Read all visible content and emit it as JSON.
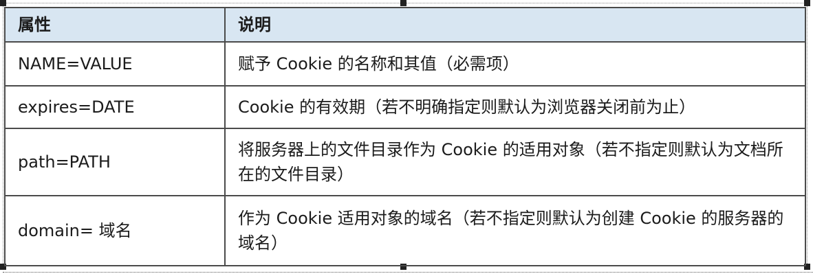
{
  "table": {
    "headers": [
      "属性",
      "说明"
    ],
    "rows": [
      {
        "attr": "NAME=VALUE",
        "desc": "赋予 Cookie 的名称和其值（必需项）"
      },
      {
        "attr": "expires=DATE",
        "desc": "Cookie 的有效期（若不明确指定则默认为浏览器关闭前为止）"
      },
      {
        "attr": "path=PATH",
        "desc": "将服务器上的文件目录作为 Cookie 的适用对象（若不指定则默认为文档所在的文件目录）"
      },
      {
        "attr": "domain= 域名",
        "desc": "作为 Cookie 适用对象的域名（若不指定则默认为创建 Cookie 的服务器的域名）"
      }
    ]
  },
  "colors": {
    "header_bg": "#d8e6f2",
    "border": "#4a4a4a",
    "text": "#1b1b1b"
  }
}
